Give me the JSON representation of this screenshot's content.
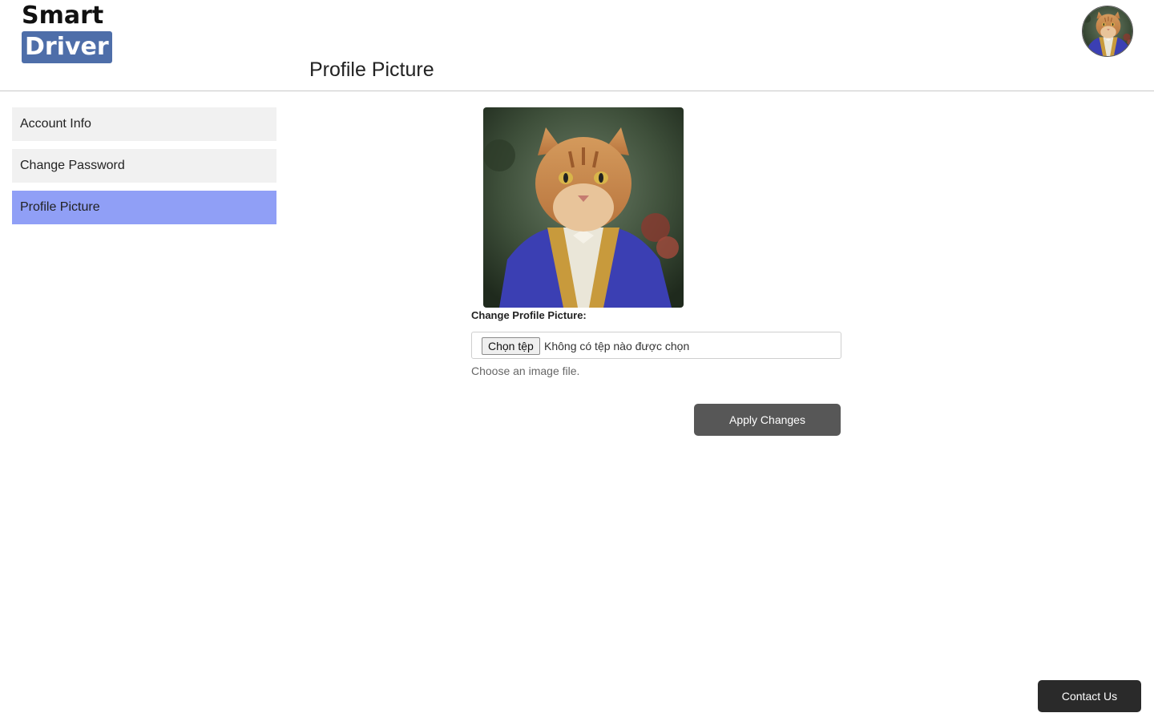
{
  "brand": {
    "line1": "Smart",
    "line2": "Driver",
    "color": "#4e6ea9"
  },
  "header": {
    "title": "Profile Picture",
    "avatar_icon": "cat-portrait-avatar"
  },
  "sidebar": {
    "items": [
      {
        "label": "Account Info",
        "active": false
      },
      {
        "label": "Change Password",
        "active": false
      },
      {
        "label": "Profile Picture",
        "active": true
      }
    ],
    "active_color": "#909ff6"
  },
  "main": {
    "picture_icon": "cat-portrait-image",
    "field_label": "Change Profile Picture:",
    "file_button_label": "Chọn tệp",
    "file_status": "Không có tệp nào được chọn",
    "help_text": "Choose an image file.",
    "apply_label": "Apply Changes"
  },
  "footer": {
    "contact_label": "Contact Us"
  }
}
